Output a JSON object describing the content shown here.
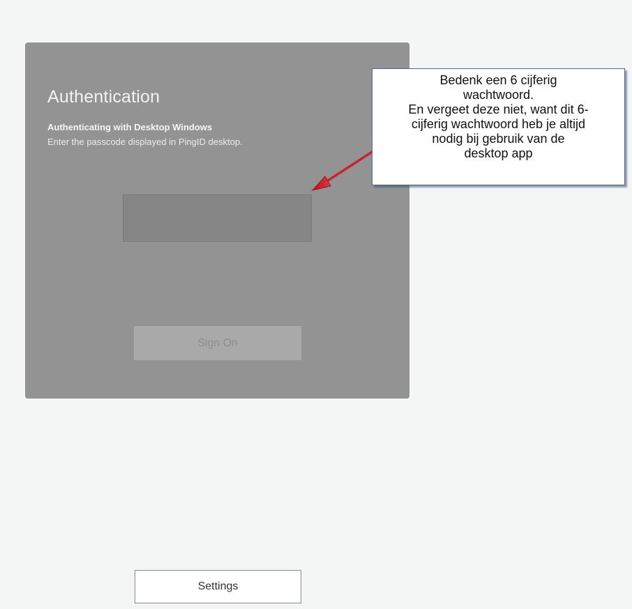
{
  "auth": {
    "title": "Authentication",
    "subtitle": "Authenticating with Desktop Windows",
    "instruction": "Enter the passcode displayed in PingID desktop.",
    "passcode_value": "",
    "sign_on_label": "Sign On"
  },
  "callout": {
    "text": "Bedenk een 6 cijferig\nwachtwoord.\nEn vergeet deze niet, want dit 6-\ncijferig wachtwoord heb je altijd\nnodig bij gebruik van de\ndesktop app"
  },
  "footer": {
    "settings_label": "Settings"
  },
  "colors": {
    "page_background": "#f4f6f6",
    "panel_background": "#939393",
    "input_background": "#868686",
    "button_disabled": "#a9a9a9",
    "arrow": "#c8232b"
  },
  "icons": {
    "annotation_arrow": "red-arrow-icon"
  }
}
